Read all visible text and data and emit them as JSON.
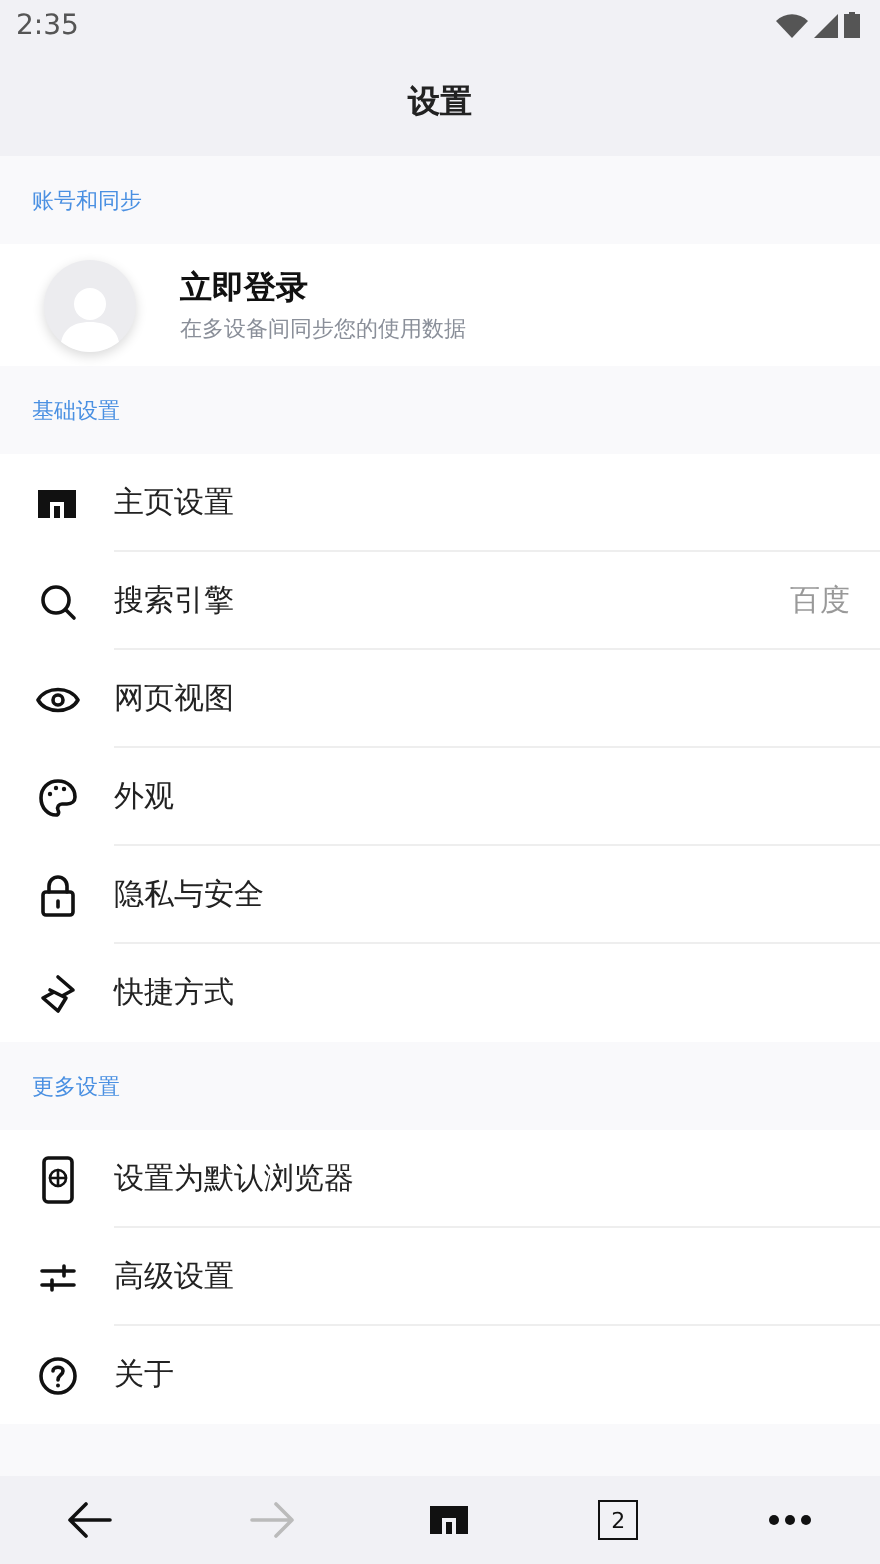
{
  "status_bar": {
    "time": "2:35"
  },
  "header": {
    "title": "设置"
  },
  "sections": [
    {
      "title": "账号和同步",
      "account": {
        "name": "立即登录",
        "subtitle": "在多设备间同步您的使用数据"
      }
    },
    {
      "title": "基础设置",
      "items": [
        {
          "label": "主页设置"
        },
        {
          "label": "搜索引擎",
          "value": "百度"
        },
        {
          "label": "网页视图"
        },
        {
          "label": "外观"
        },
        {
          "label": "隐私与安全"
        },
        {
          "label": "快捷方式"
        }
      ]
    },
    {
      "title": "更多设置",
      "items": [
        {
          "label": "设置为默认浏览器"
        },
        {
          "label": "高级设置"
        },
        {
          "label": "关于"
        }
      ]
    }
  ],
  "bottom_bar": {
    "forward_disabled": true,
    "tab_count": "2"
  }
}
